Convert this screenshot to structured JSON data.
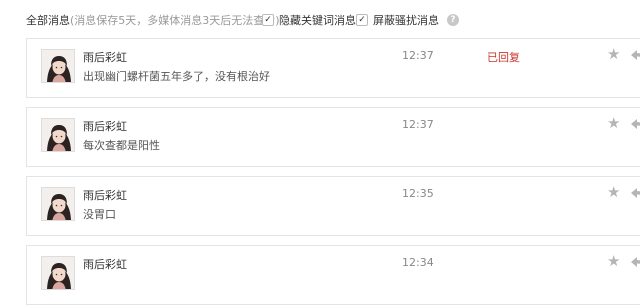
{
  "header": {
    "title": "全部消息",
    "note": "(消息保存5天，多媒体消息3天后无法查看)",
    "filters": [
      {
        "label": "隐藏关键词消息",
        "checked": true
      },
      {
        "label": "屏蔽骚扰消息",
        "checked": true
      }
    ],
    "help_icon": "question-circle-icon",
    "help_glyph": "?"
  },
  "messages": [
    {
      "name": "雨后彩虹",
      "text": "出现幽门螺杆菌五年多了，没有根治好",
      "time": "12:37",
      "status": "已回复"
    },
    {
      "name": "雨后彩虹",
      "text": "每次查都是阳性",
      "time": "12:37",
      "status": ""
    },
    {
      "name": "雨后彩虹",
      "text": "没胃口",
      "time": "12:35",
      "status": ""
    },
    {
      "name": "雨后彩虹",
      "text": "",
      "time": "12:34",
      "status": ""
    }
  ],
  "icons": {
    "star": "★",
    "check": "✓"
  },
  "colors": {
    "replied_status": "#c9352b",
    "icon_gray": "#b5b5b5"
  }
}
